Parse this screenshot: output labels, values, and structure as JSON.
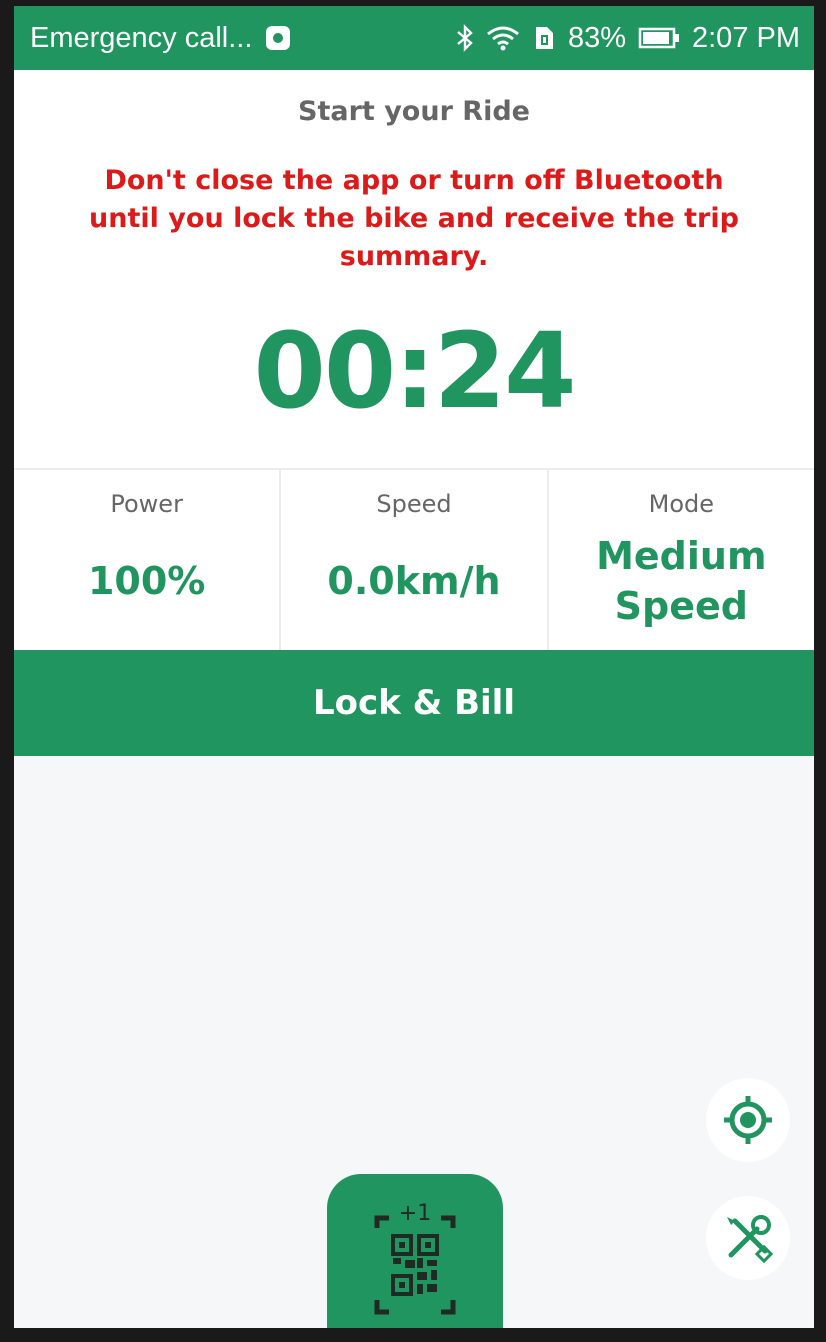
{
  "statusbar": {
    "carrier": "Emergency call...",
    "battery": "83%",
    "time": "2:07 PM"
  },
  "ride": {
    "title": "Start your Ride",
    "warning": "Don't close the app or turn off Bluetooth until you lock the bike and receive the trip summary.",
    "timer": "00:24"
  },
  "stats": [
    {
      "label": "Power",
      "value": "100%"
    },
    {
      "label": "Speed",
      "value": "0.0km/h"
    },
    {
      "label": "Mode",
      "value": "Medium Speed"
    }
  ],
  "lock_button": "Lock & Bill",
  "scan": {
    "badge": "+1"
  },
  "icons": {
    "notification": "notification-icon",
    "bluetooth": "bluetooth-icon",
    "wifi": "wifi-icon",
    "sim": "sim-card-icon",
    "battery": "battery-icon",
    "locate": "locate-icon",
    "tools": "tools-icon",
    "qr": "qr-scan-icon"
  },
  "colors": {
    "brand": "#21955f",
    "warning": "#dd1a1a"
  }
}
